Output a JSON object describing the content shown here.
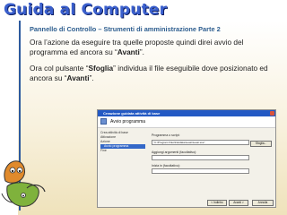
{
  "slide": {
    "title": "Guida al Computer",
    "subtitle": "Pannello di Controllo – Strumenti di amministrazione Parte 2",
    "p1_before": "Ora l’azione da eseguire tra quelle proposte quindi direi avvio del programma ed ancora su “",
    "p1_bold": "Avanti",
    "p1_after": "”.",
    "p2_before": "Ora col pulsante “",
    "p2_bold": "Sfoglia",
    "p2_middle": "” individua il file eseguibile dove posizionato ed ancora su “",
    "p2_bold2": "Avanti",
    "p2_after": "”."
  },
  "wizard": {
    "window_title": "Creazione guidata attività di base",
    "heading": "Avvio programma",
    "nav": [
      "Crea attività di base",
      "Attivazione",
      "Azione",
      "Avvio programma",
      "Fine"
    ],
    "program_label": "Programma o script:",
    "program_value": "\"C:\\Program Files\\Netdata\\Leasi\\Leasi.exe\"",
    "browse_button": "Sfoglia...",
    "args_label": "Aggiungi argomenti (facoltativo):",
    "start_label": "Inizia in (facoltativo):",
    "back_button": "< Indietro",
    "next_button": "Avanti >",
    "cancel_button": "Annulla"
  },
  "colors": {
    "title": "#3a5fcd",
    "subtitle": "#2d5d8f",
    "accent_rule": "#2d5a9e",
    "wizard_titlebar": "#2359c4",
    "nav_selected": "#3468c8"
  },
  "icons": [
    "app-icon",
    "close-icon",
    "decorative-characters"
  ]
}
